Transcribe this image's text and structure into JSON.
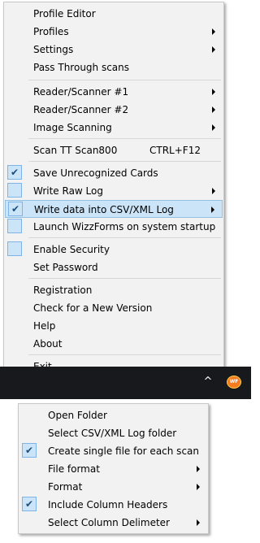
{
  "main_menu": {
    "profile_editor": "Profile Editor",
    "profiles": "Profiles",
    "settings": "Settings",
    "pass_through_scans": "Pass Through scans",
    "reader_scanner_1": "Reader/Scanner #1",
    "reader_scanner_2": "Reader/Scanner #2",
    "image_scanning": "Image Scanning",
    "scan_tt_scan800": "Scan TT Scan800",
    "scan_tt_shortcut": "CTRL+F12",
    "save_unrecognized_cards": "Save Unrecognized Cards",
    "save_unrecognized_cards_checked": true,
    "write_raw_log": "Write Raw Log",
    "write_raw_log_checked": false,
    "write_data_csv_xml": "Write data into CSV/XML Log",
    "write_data_csv_xml_checked": true,
    "launch_wizzforms": "Launch WizzForms on system startup",
    "launch_wizzforms_checked": false,
    "enable_security": "Enable Security",
    "enable_security_checked": false,
    "set_password": "Set Password",
    "registration": "Registration",
    "check_new_version": "Check for a New Version",
    "help": "Help",
    "about": "About",
    "exit": "Exit"
  },
  "tray": {
    "chevron_glyph": "^",
    "app_icon_text": "WF"
  },
  "sub_menu": {
    "open_folder": "Open Folder",
    "select_log_folder": "Select CSV/XML Log folder",
    "create_single_file": "Create single file for each scan",
    "create_single_file_checked": true,
    "file_format": "File format",
    "format": "Format",
    "include_column_headers": "Include Column Headers",
    "include_column_headers_checked": true,
    "select_column_delimeter": "Select Column Delimeter"
  },
  "colors": {
    "menu_background": "#f2f2f2",
    "highlight": "#cce4f7",
    "taskbar": "#17191c"
  }
}
